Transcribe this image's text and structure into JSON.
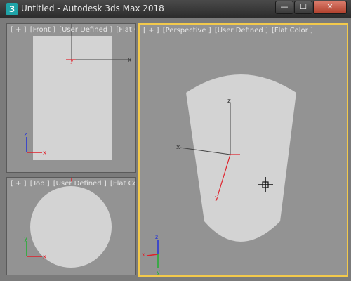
{
  "window": {
    "icon_glyph": "3",
    "title": "Untitled - Autodesk 3ds Max 2018",
    "minimize_glyph": "—",
    "maximize_glyph": "☐",
    "close_glyph": "✕"
  },
  "viewports": {
    "front": {
      "labels": [
        "[ + ]",
        "[Front ]",
        "[User Defined ]",
        "[Flat Co"
      ]
    },
    "top": {
      "labels": [
        "[ + ]",
        "[Top ]",
        "[User Defined ]",
        "[Flat Colo"
      ]
    },
    "perspective": {
      "labels": [
        "[ + ]",
        "[Perspective ]",
        "[User Defined ]",
        "[Flat Color ]"
      ]
    }
  },
  "axis_letters": {
    "x": "x",
    "y": "y",
    "z": "z"
  },
  "colors": {
    "viewport_bg": "#939393",
    "object": "#d3d3d3",
    "active_border": "#f2c94c",
    "axis_x": "#e0202a",
    "axis_y": "#1fae2f",
    "axis_z": "#2230d8"
  },
  "icons": {
    "app": "3ds-max-icon",
    "cursor": "move-crosshair-icon"
  }
}
